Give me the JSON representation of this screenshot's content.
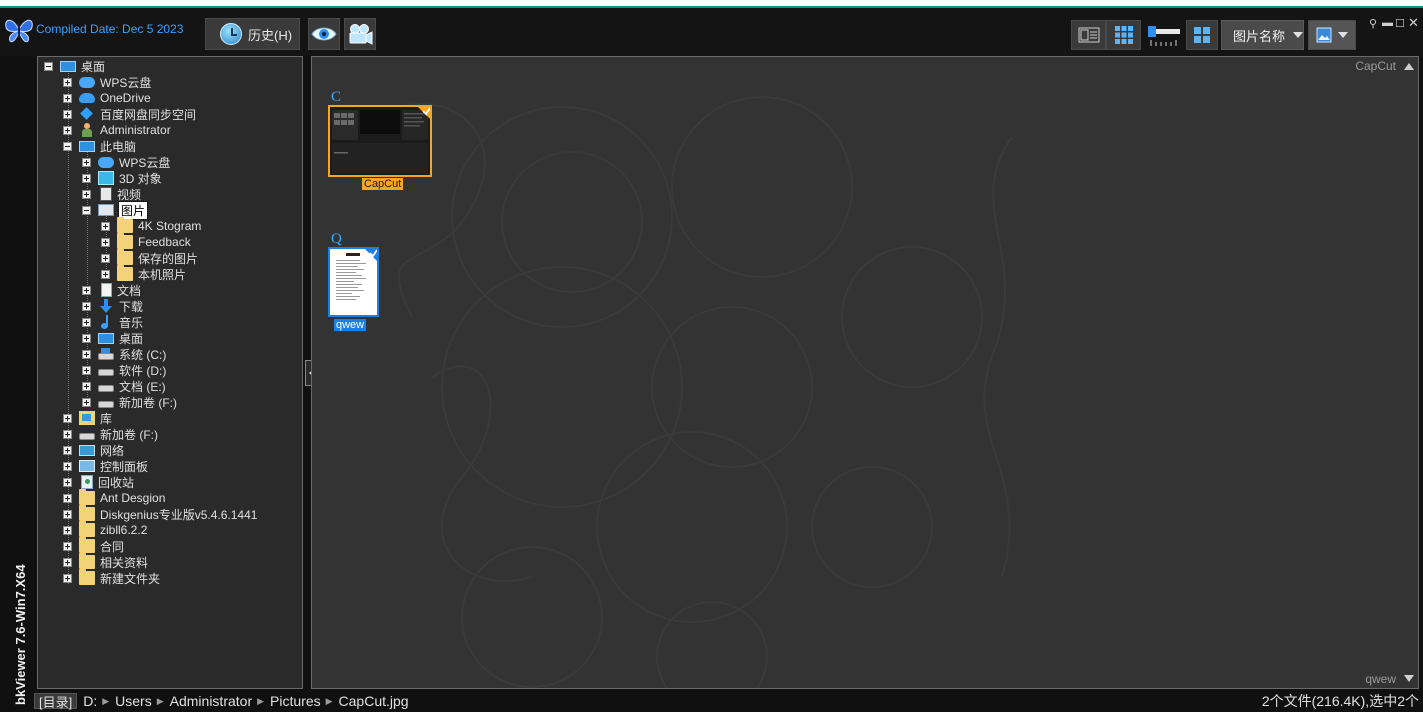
{
  "app": {
    "compiled": "Compiled Date: Dec  5 2023",
    "vertical_title": "bkViewer 7.6-Win7.X64"
  },
  "toolbar": {
    "history_label": "历史(H)",
    "sort_label": "图片名称",
    "icons": [
      "history-clock-icon",
      "eye-icon",
      "slideshow-camera-icon",
      "info-view-icon",
      "grid-view-icon",
      "thumbnail-size-slider-icon",
      "layout-icon",
      "sort-dropdown",
      "image-menu-icon"
    ],
    "window_controls": [
      "pin-icon",
      "minimize-icon",
      "maximize-icon",
      "close-icon"
    ]
  },
  "tree": [
    {
      "label": "桌面",
      "level": 0,
      "icon": "monitor",
      "expanded": true
    },
    {
      "label": "WPS云盘",
      "level": 1,
      "icon": "cloud-wps"
    },
    {
      "label": "OneDrive",
      "level": 1,
      "icon": "cloud"
    },
    {
      "label": "百度网盘同步空间",
      "level": 1,
      "icon": "sync"
    },
    {
      "label": "Administrator",
      "level": 1,
      "icon": "user"
    },
    {
      "label": "此电脑",
      "level": 1,
      "icon": "monitor",
      "expanded": true
    },
    {
      "label": "WPS云盘",
      "level": 2,
      "icon": "cloud-wps"
    },
    {
      "label": "3D 对象",
      "level": 2,
      "icon": "cube"
    },
    {
      "label": "视频",
      "level": 2,
      "icon": "film"
    },
    {
      "label": "图片",
      "level": 2,
      "icon": "pic",
      "expanded": true,
      "selected": true
    },
    {
      "label": "4K Stogram",
      "level": 3,
      "icon": "folder"
    },
    {
      "label": "Feedback",
      "level": 3,
      "icon": "folder"
    },
    {
      "label": "保存的图片",
      "level": 3,
      "icon": "folder"
    },
    {
      "label": "本机照片",
      "level": 3,
      "icon": "folder"
    },
    {
      "label": "文档",
      "level": 2,
      "icon": "doc"
    },
    {
      "label": "下载",
      "level": 2,
      "icon": "down"
    },
    {
      "label": "音乐",
      "level": 2,
      "icon": "music"
    },
    {
      "label": "桌面",
      "level": 2,
      "icon": "monitor"
    },
    {
      "label": "系统 (C:)",
      "level": 2,
      "icon": "drive drive-sys"
    },
    {
      "label": "软件 (D:)",
      "level": 2,
      "icon": "drive"
    },
    {
      "label": "文档 (E:)",
      "level": 2,
      "icon": "drive"
    },
    {
      "label": "新加卷 (F:)",
      "level": 2,
      "icon": "drive"
    },
    {
      "label": "库",
      "level": 1,
      "icon": "lib"
    },
    {
      "label": "新加卷 (F:)",
      "level": 1,
      "icon": "drive"
    },
    {
      "label": "网络",
      "level": 1,
      "icon": "net"
    },
    {
      "label": "控制面板",
      "level": 1,
      "icon": "ctrl"
    },
    {
      "label": "回收站",
      "level": 1,
      "icon": "bin"
    },
    {
      "label": "Ant Desgion",
      "level": 1,
      "icon": "folder"
    },
    {
      "label": "Diskgenius专业版v5.4.6.1441",
      "level": 1,
      "icon": "folder"
    },
    {
      "label": "zibll6.2.2",
      "level": 1,
      "icon": "folder"
    },
    {
      "label": "合同",
      "level": 1,
      "icon": "folder"
    },
    {
      "label": "相关资料",
      "level": 1,
      "icon": "folder"
    },
    {
      "label": "新建文件夹",
      "level": 1,
      "icon": "folder"
    }
  ],
  "viewer": {
    "top_tag": "CapCut",
    "bottom_tag": "qwew",
    "groups": [
      {
        "letter": "C",
        "file": "CapCut",
        "accent": "#f5a623",
        "checked": true
      },
      {
        "letter": "Q",
        "file": "qwew",
        "accent": "#1e7fe0",
        "checked": true
      }
    ]
  },
  "status": {
    "dir_label": "[目录]",
    "path": [
      "D:",
      "Users",
      "Administrator",
      "Pictures",
      "CapCut.jpg"
    ],
    "summary": "2个文件(216.4K),选中2个"
  },
  "colors": {
    "selection_orange": "#f5a623",
    "selection_blue": "#1e7fe0",
    "letter_blue": "#38a8ff",
    "compiled_blue": "#3aa0ff"
  }
}
